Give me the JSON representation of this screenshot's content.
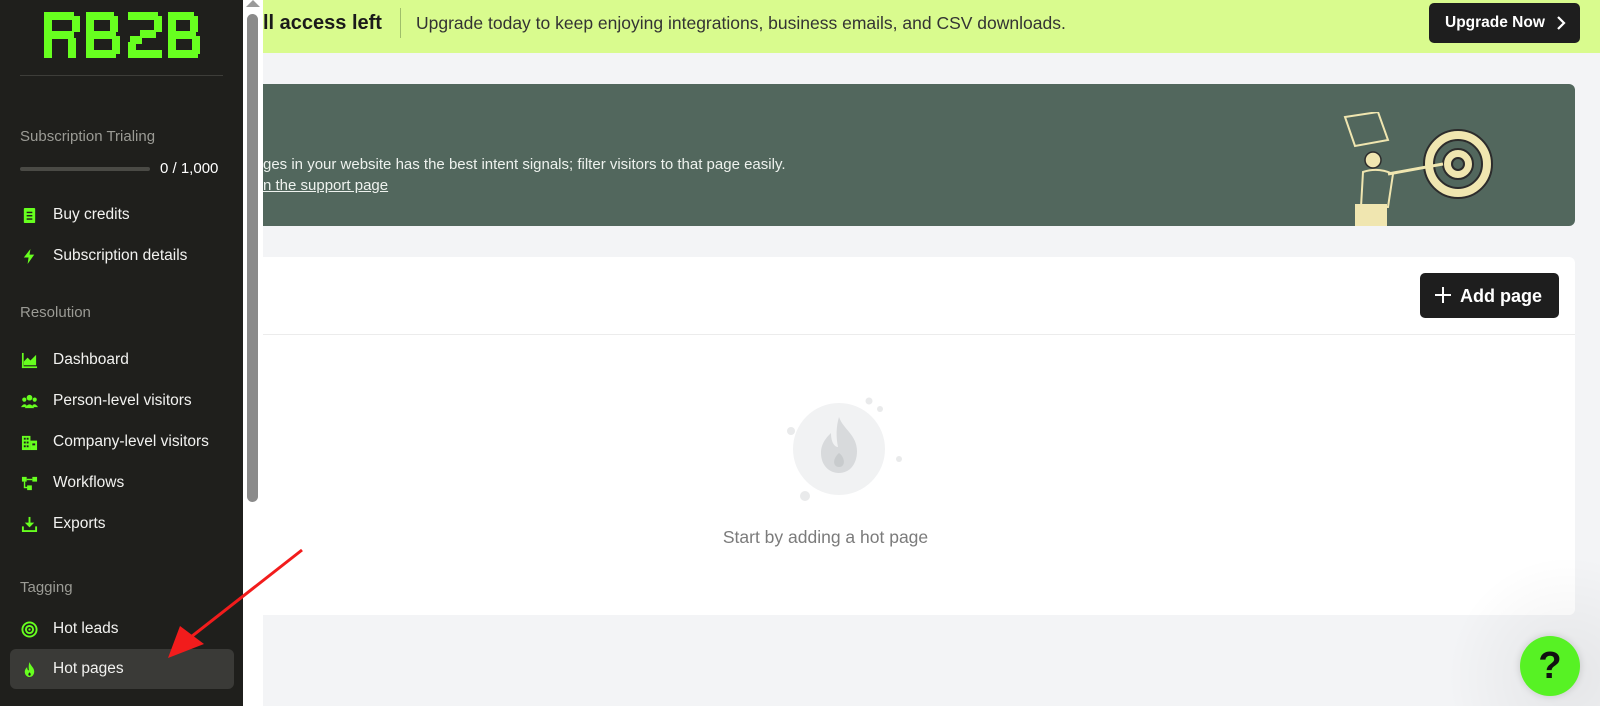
{
  "sidebar": {
    "logo_text": "RB2B",
    "subscription": {
      "label": "Subscription Trialing",
      "credits": "0 / 1,000",
      "progress_fraction": 0
    },
    "account_items": [
      {
        "label": "Buy credits",
        "icon": "receipt-icon"
      },
      {
        "label": "Subscription details",
        "icon": "lightning-icon"
      }
    ],
    "resolution_label": "Resolution",
    "resolution_items": [
      {
        "label": "Dashboard",
        "icon": "chart-icon"
      },
      {
        "label": "Person-level visitors",
        "icon": "users-icon"
      },
      {
        "label": "Company-level visitors",
        "icon": "building-icon"
      },
      {
        "label": "Workflows",
        "icon": "workflow-icon"
      },
      {
        "label": "Exports",
        "icon": "download-icon"
      }
    ],
    "tagging_label": "Tagging",
    "tagging_items": [
      {
        "label": "Hot leads",
        "icon": "target-icon"
      },
      {
        "label": "Hot pages",
        "icon": "flame-icon",
        "active": true
      }
    ]
  },
  "banner": {
    "title": "ll access left",
    "text": "Upgrade today to keep enjoying integrations, business emails, and CSV downloads.",
    "upgrade_label": "Upgrade Now"
  },
  "info_card": {
    "text": "ges in your website has the best intent signals; filter visitors to that page easily.",
    "link": "n the support page"
  },
  "main_card": {
    "add_label": "Add page",
    "empty_text": "Start by adding a hot page"
  },
  "help": {
    "label": "?"
  },
  "colors": {
    "accent_green": "#67ff1f",
    "sidebar_bg": "#1f1f1c",
    "banner_bg": "#d9fb8e",
    "info_bg": "#52675d"
  }
}
